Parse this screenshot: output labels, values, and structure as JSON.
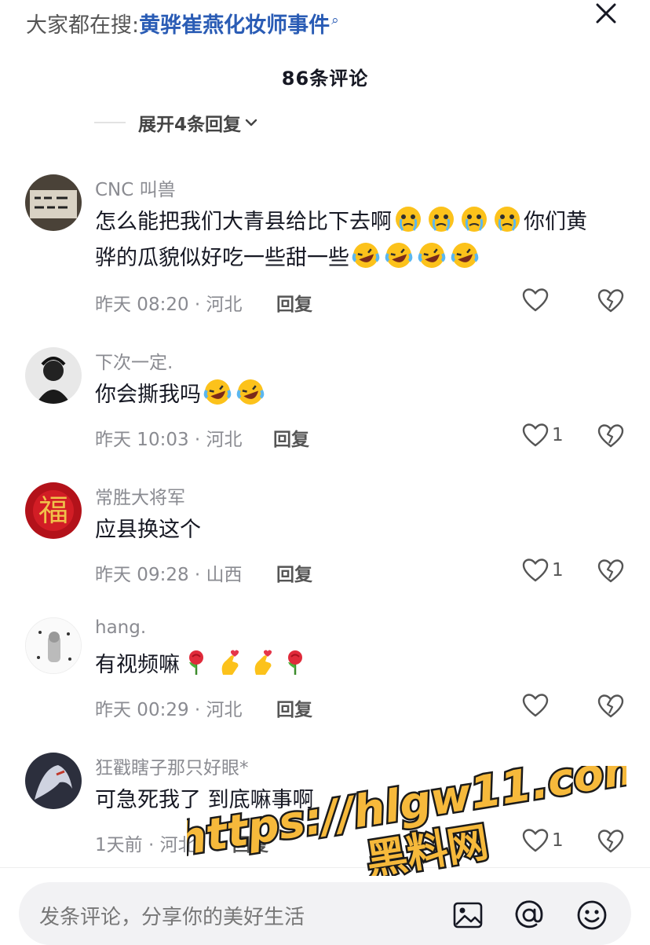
{
  "search": {
    "prefix": "大家都在搜:",
    "term": "黄骅崔燕化妆师事件"
  },
  "header": {
    "count": "86条评论",
    "expand": "展开4条回复"
  },
  "comments": [
    {
      "user": "CNC 叫兽",
      "text": "怎么能把我们大青县给比下去啊",
      "text2": "你们黄",
      "text3": "骅的瓜貌似好吃一些甜一些",
      "time": "昨天 08:20 · 河北",
      "reply": "回复",
      "likes": ""
    },
    {
      "user": "下次一定.",
      "text": "你会撕我吗",
      "time": "昨天 10:03 · 河北",
      "reply": "回复",
      "likes": "1"
    },
    {
      "user": "常胜大将军",
      "text": "应县换这个",
      "time": "昨天 09:28 · 山西",
      "reply": "回复",
      "likes": "1"
    },
    {
      "user": "hang.",
      "text": "有视频嘛",
      "time": "昨天 00:29 · 河北",
      "reply": "回复",
      "likes": ""
    },
    {
      "user": "狂戳瞎子那只好眼*",
      "text": "可急死我了  到底嘛事啊",
      "time": "1天前 · 河北",
      "reply": "回复",
      "likes": "1"
    }
  ],
  "composer": {
    "placeholder": "发条评论，分享你的美好生活"
  },
  "watermark": {
    "line1": "https://hlgw11.com",
    "line2": "黑料网"
  },
  "colors": {
    "link": "#2a5cb5",
    "meta": "#8a8b91",
    "watermark_fill": "#f6b93b",
    "watermark_stroke": "#1a1a1a"
  }
}
